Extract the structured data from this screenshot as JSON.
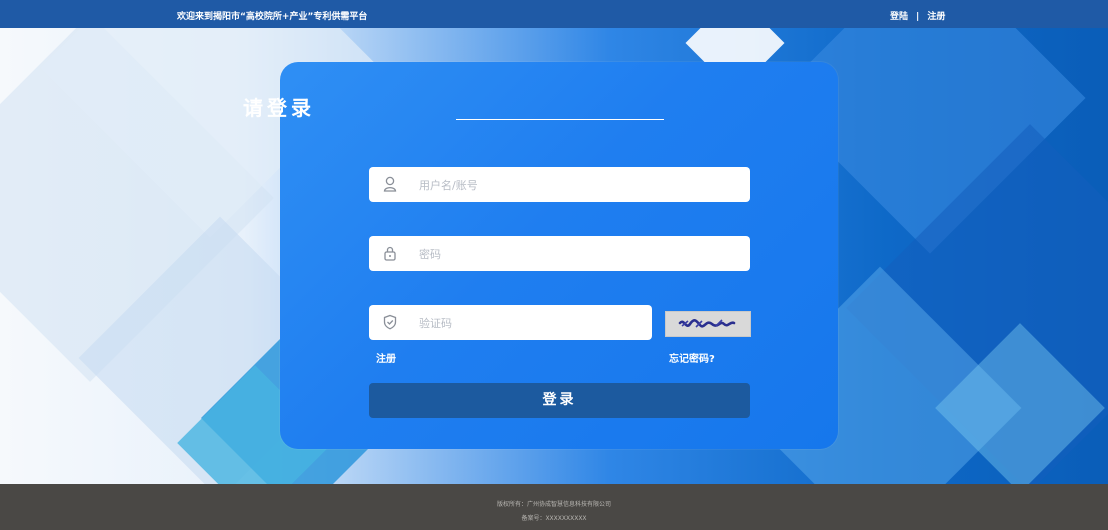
{
  "header": {
    "welcome_text": "欢迎来到揭阳市“高校院所+产业”专利供需平台",
    "login_link": "登陆",
    "separator": "|",
    "register_link": "注册"
  },
  "login_form": {
    "title": "请登录",
    "username_placeholder": "用户名/账号",
    "password_placeholder": "密码",
    "captcha_placeholder": "验证码",
    "register_link": "注册",
    "forgot_password_link": "忘记密码?",
    "submit_label": "登录"
  },
  "footer": {
    "copyright": "版权所有：广州协成智慧信息科技有限公司",
    "record_number": "备案号：XXXXXXXXXX"
  },
  "colors": {
    "topbar": "#1f5aa6",
    "card": "#1f7ef0",
    "button": "#1c5a9f",
    "footer": "#4a4845"
  },
  "icons": [
    "user-icon",
    "lock-icon",
    "shield-icon",
    "captcha-image"
  ]
}
